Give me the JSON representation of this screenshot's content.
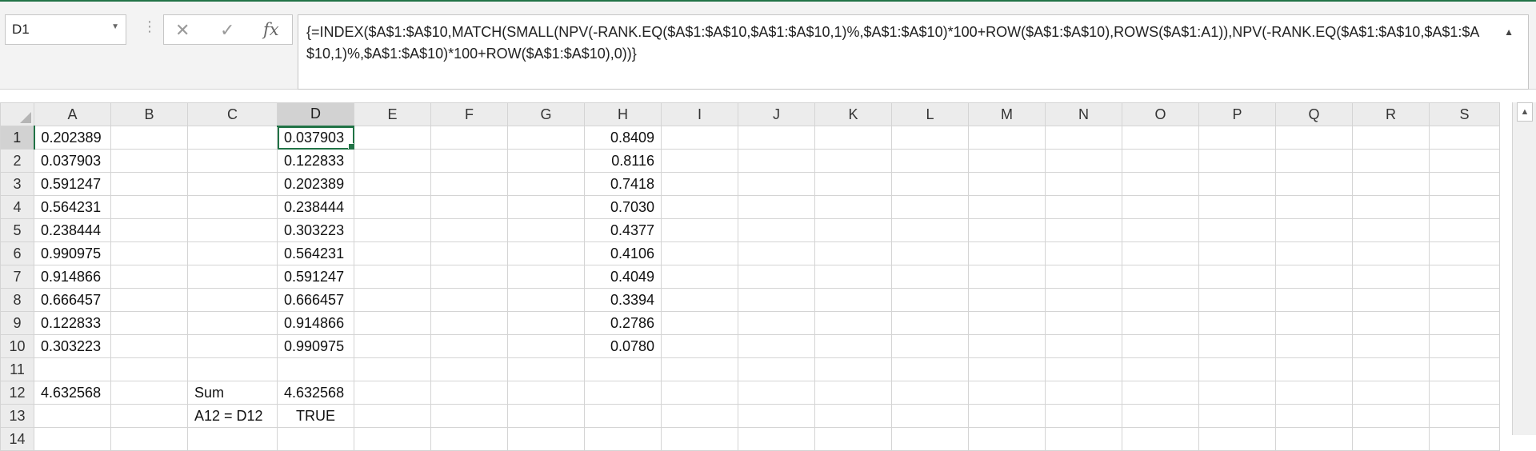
{
  "name_box": {
    "value": "D1"
  },
  "formula_bar": {
    "text": "{=INDEX($A$1:$A$10,MATCH(SMALL(NPV(-RANK.EQ($A$1:$A$10,$A$1:$A$10,1)%,$A$1:$A$10)*100+ROW($A$1:$A$10),ROWS($A$1:A1)),NPV(-RANK.EQ($A$1:$A$10,$A$1:$A$10,1)%,$A$1:$A$10)*100+ROW($A$1:$A$10),0))}",
    "cancel_icon": "cancel-icon",
    "enter_icon": "checkmark-icon",
    "fx_label": "fx"
  },
  "sheet": {
    "columns": [
      "A",
      "B",
      "C",
      "D",
      "E",
      "F",
      "G",
      "H",
      "I",
      "J",
      "K",
      "L",
      "M",
      "N",
      "O",
      "P",
      "Q",
      "R",
      "S"
    ],
    "selected_column": "D",
    "selected_row": "1",
    "rows": [
      {
        "row": "1",
        "A": "0.202389",
        "D": "0.037903",
        "H": "0.8409"
      },
      {
        "row": "2",
        "A": "0.037903",
        "D": "0.122833",
        "H": "0.8116"
      },
      {
        "row": "3",
        "A": "0.591247",
        "D": "0.202389",
        "H": "0.7418"
      },
      {
        "row": "4",
        "A": "0.564231",
        "D": "0.238444",
        "H": "0.7030"
      },
      {
        "row": "5",
        "A": "0.238444",
        "D": "0.303223",
        "H": "0.4377"
      },
      {
        "row": "6",
        "A": "0.990975",
        "D": "0.564231",
        "H": "0.4106"
      },
      {
        "row": "7",
        "A": "0.914866",
        "D": "0.591247",
        "H": "0.4049"
      },
      {
        "row": "8",
        "A": "0.666457",
        "D": "0.666457",
        "H": "0.3394"
      },
      {
        "row": "9",
        "A": "0.122833",
        "D": "0.914866",
        "H": "0.2786"
      },
      {
        "row": "10",
        "A": "0.303223",
        "D": "0.990975",
        "H": "0.0780"
      },
      {
        "row": "11"
      },
      {
        "row": "12",
        "A": "4.632568",
        "C": "Sum",
        "D": "4.632568"
      },
      {
        "row": "13",
        "C": "A12 = D12",
        "D": "TRUE"
      },
      {
        "row": "14"
      }
    ]
  },
  "colors": {
    "accent": "#217346",
    "header_bg": "#ececec",
    "grid_line": "#d4d4d4"
  }
}
